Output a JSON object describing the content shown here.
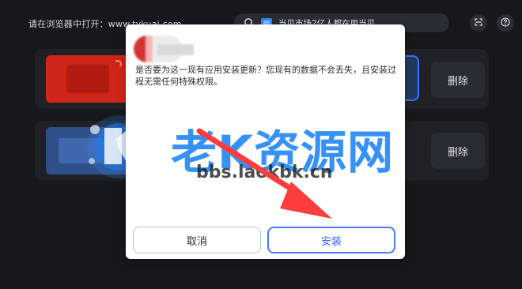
{
  "top_bar": {
    "browser_hint": "请在浏览器中打开：www.tvkuai.com",
    "search_text": "当贝市场2亿人都在用当贝"
  },
  "rows": [
    {
      "delete_label": "删除"
    },
    {
      "delete_label": "删除"
    }
  ],
  "dialog": {
    "message": "是否要为这一现有应用安装更新？您现有的数据不会丢失，且安装过程无需任何特殊权限。",
    "cancel_label": "取消",
    "install_label": "安装"
  },
  "watermark": {
    "title": "老K资源网",
    "url": "bbs.laokbk.cn"
  },
  "colors": {
    "background": "#17181c",
    "accent_blue": "#3573ff",
    "arrow_red": "#ff3b3b"
  },
  "icons": {
    "search_left": "message-icon",
    "scan": "scan-icon",
    "help": "help-icon"
  }
}
